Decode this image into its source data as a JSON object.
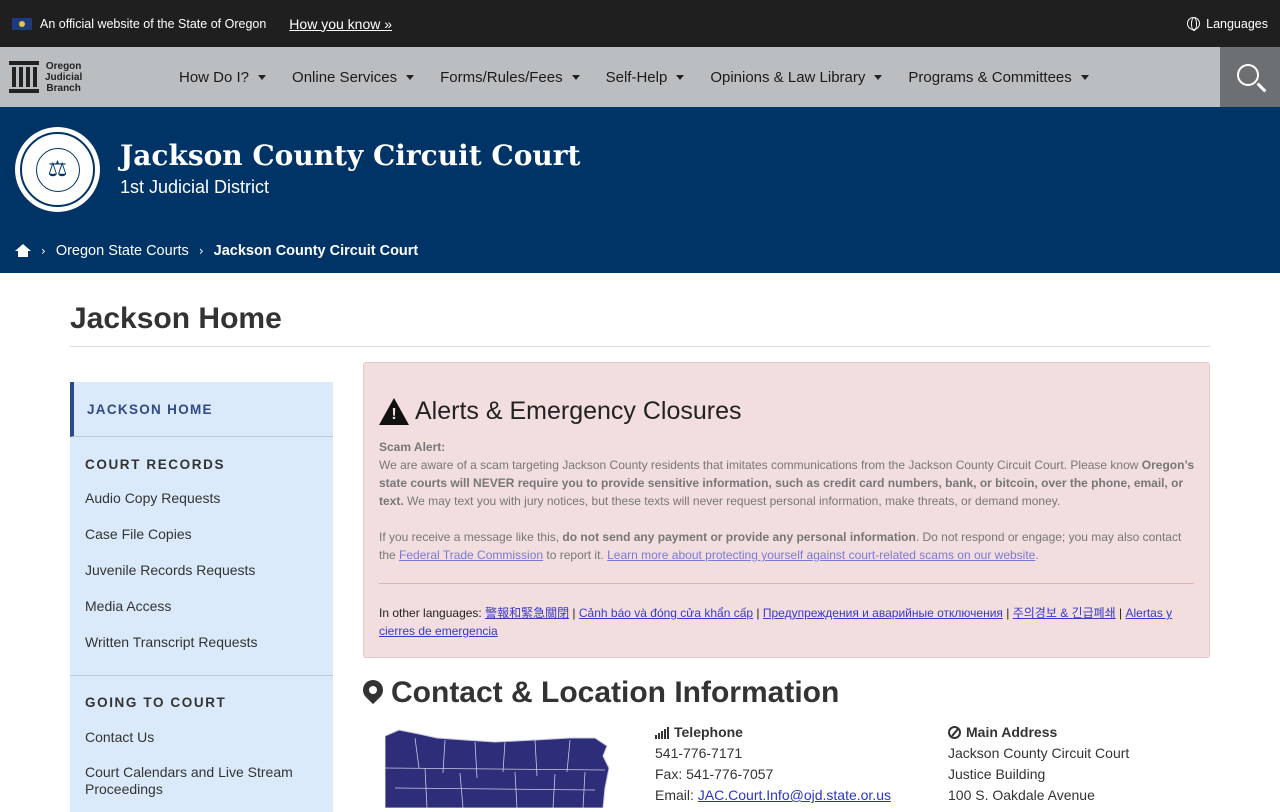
{
  "official_banner": {
    "text": "An official website of the State of Oregon",
    "how_link": "How you know »",
    "languages": "Languages"
  },
  "nav": {
    "brand": [
      "Oregon",
      "Judicial",
      "Branch"
    ],
    "items": [
      {
        "label": "How Do I?"
      },
      {
        "label": "Online Services"
      },
      {
        "label": "Forms/Rules/Fees"
      },
      {
        "label": "Self-Help"
      },
      {
        "label": "Opinions & Law Library"
      },
      {
        "label": "Programs & Committees"
      }
    ]
  },
  "header": {
    "title": "Jackson County Circuit Court",
    "subtitle": "1st Judicial District",
    "seal_text": "⚖"
  },
  "breadcrumb": {
    "items": [
      "Oregon State Courts",
      "Jackson County Circuit Court"
    ]
  },
  "page": {
    "title": "Jackson Home"
  },
  "sidebar": {
    "home": "JACKSON HOME",
    "sections": [
      {
        "title": "COURT RECORDS",
        "links": [
          "Audio Copy Requests",
          "Case File Copies",
          "Juvenile Records Requests",
          "Media Access",
          "Written Transcript Requests"
        ]
      },
      {
        "title": "GOING TO COURT",
        "links": [
          "Contact Us",
          "Court Calendars and Live Stream Proceedings"
        ]
      }
    ]
  },
  "alert": {
    "heading": "Alerts & Emergency Closures",
    "scam_label": "Scam Alert:",
    "p1_a": "We are aware of a scam targeting Jackson County residents that imitates communications from the Jackson County Circuit Court. Please know ",
    "p1_b": "Oregon’s state courts will NEVER require you to provide sensitive information, such as credit card numbers, bank, or bitcoin, over the phone, email, or text.",
    "p1_c": " We may text you with jury notices, but these texts will never request personal information, make threats, or demand money.",
    "p2_a": "If you receive a message like this, ",
    "p2_b": "do not send any payment or provide any personal information",
    "p2_c": ". Do not respond or engage; you may also contact the ",
    "ftc_link": "Federal Trade Commission",
    "p2_d": " to report it. ",
    "learn_link": "Learn more about protecting yourself against court-related scams on our website",
    "p2_e": ".",
    "langs_label": "In other languages: ",
    "lang_links": [
      "警報和緊急關閉",
      "Cảnh báo và đóng cửa khẩn cấp",
      "Предупреждения и аварийные отключения",
      "주의경보 & 긴급폐쇄",
      "Alertas y cierres de emergencia"
    ]
  },
  "contact": {
    "heading": "Contact & Location Information",
    "telephone_label": "Telephone",
    "phone": "541-776-7171",
    "fax": "Fax:  541-776-7057",
    "email_label": "Email: ",
    "email": "JAC.Court.Info@ojd.state.or.us",
    "address_label": "Main Address",
    "address": [
      "Jackson County Circuit Court",
      "Justice Building",
      "100 S. Oakdale Avenue"
    ]
  },
  "colors": {
    "header_bg": "#003366",
    "nav_bg": "#babec1",
    "alert_bg": "#f2dede",
    "sidebar_bg": "#dbeafa",
    "map_fill": "#2e2d7a"
  }
}
